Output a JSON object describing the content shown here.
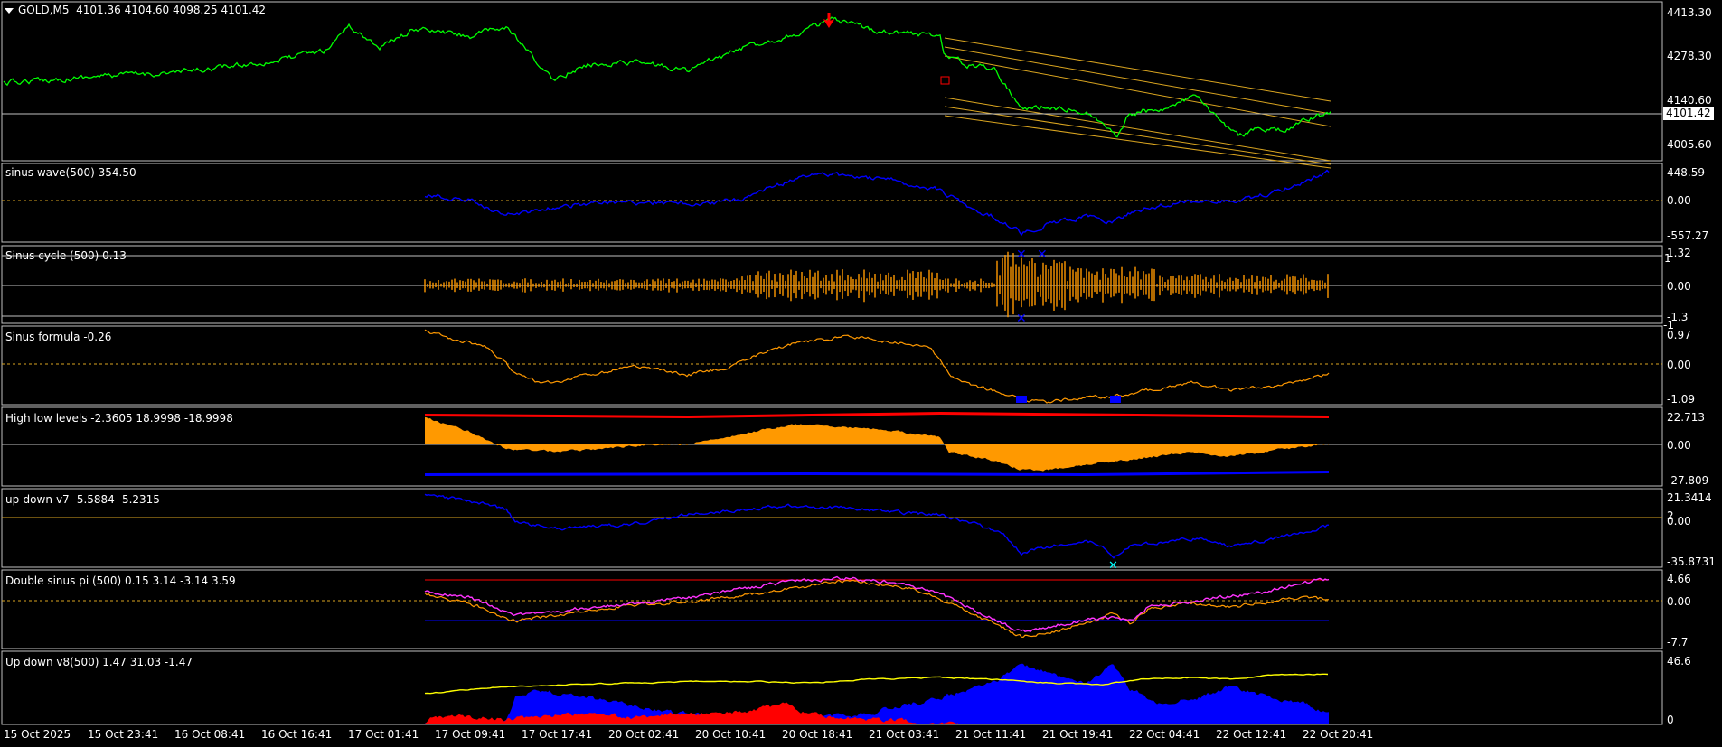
{
  "main": {
    "symbol_label": "GOLD,M5",
    "ohlc": "4101.36 4104.60 4098.25 4101.42",
    "current_price": "4101.42",
    "price_labels": [
      "4413.30",
      "4278.30",
      "4140.60",
      "4005.60"
    ]
  },
  "panels": [
    {
      "title": "sinus wave(500) 354.50",
      "labels": [
        "448.59",
        "0.00",
        "-557.27"
      ]
    },
    {
      "title": "Sinus cycle (500) 0.13",
      "labels": [
        "1.32",
        "1",
        "0.00",
        "-1.3",
        "-1"
      ]
    },
    {
      "title": "Sinus formula -0.26",
      "labels": [
        "0.97",
        "0.00",
        "-1.09"
      ]
    },
    {
      "title": "High low levels -2.3605 18.9998 -18.9998",
      "labels": [
        "22.713",
        "0.00",
        "-27.809"
      ]
    },
    {
      "title": "up-down-v7 -5.5884 -5.2315",
      "labels": [
        "21.3414",
        "2",
        "0.00",
        "-35.8731"
      ]
    },
    {
      "title": "Double sinus pi (500) 0.15 3.14 -3.14 3.59",
      "labels": [
        "4.66",
        "0.00",
        "-7.7"
      ]
    },
    {
      "title": "Up down v8(500) 1.47 31.03 -1.47",
      "labels": [
        "46.6",
        "0"
      ]
    }
  ],
  "time_axis": [
    "15 Oct 2025",
    "15 Oct 23:41",
    "16 Oct 08:41",
    "16 Oct 16:41",
    "17 Oct 01:41",
    "17 Oct 09:41",
    "17 Oct 17:41",
    "20 Oct 02:41",
    "20 Oct 10:41",
    "20 Oct 18:41",
    "21 Oct 03:41",
    "21 Oct 11:41",
    "21 Oct 19:41",
    "22 Oct 04:41",
    "22 Oct 12:41",
    "22 Oct 20:41"
  ],
  "colors": {
    "background": "#000000",
    "price_line": "#00ff00",
    "channel": "#daa520",
    "blue_line": "#0000ff",
    "orange": "#ff9900",
    "red": "#ff0000",
    "magenta": "#ff33ff",
    "yellow": "#ffff00",
    "cyan": "#00ffff",
    "separator": "#c0c0c0"
  }
}
